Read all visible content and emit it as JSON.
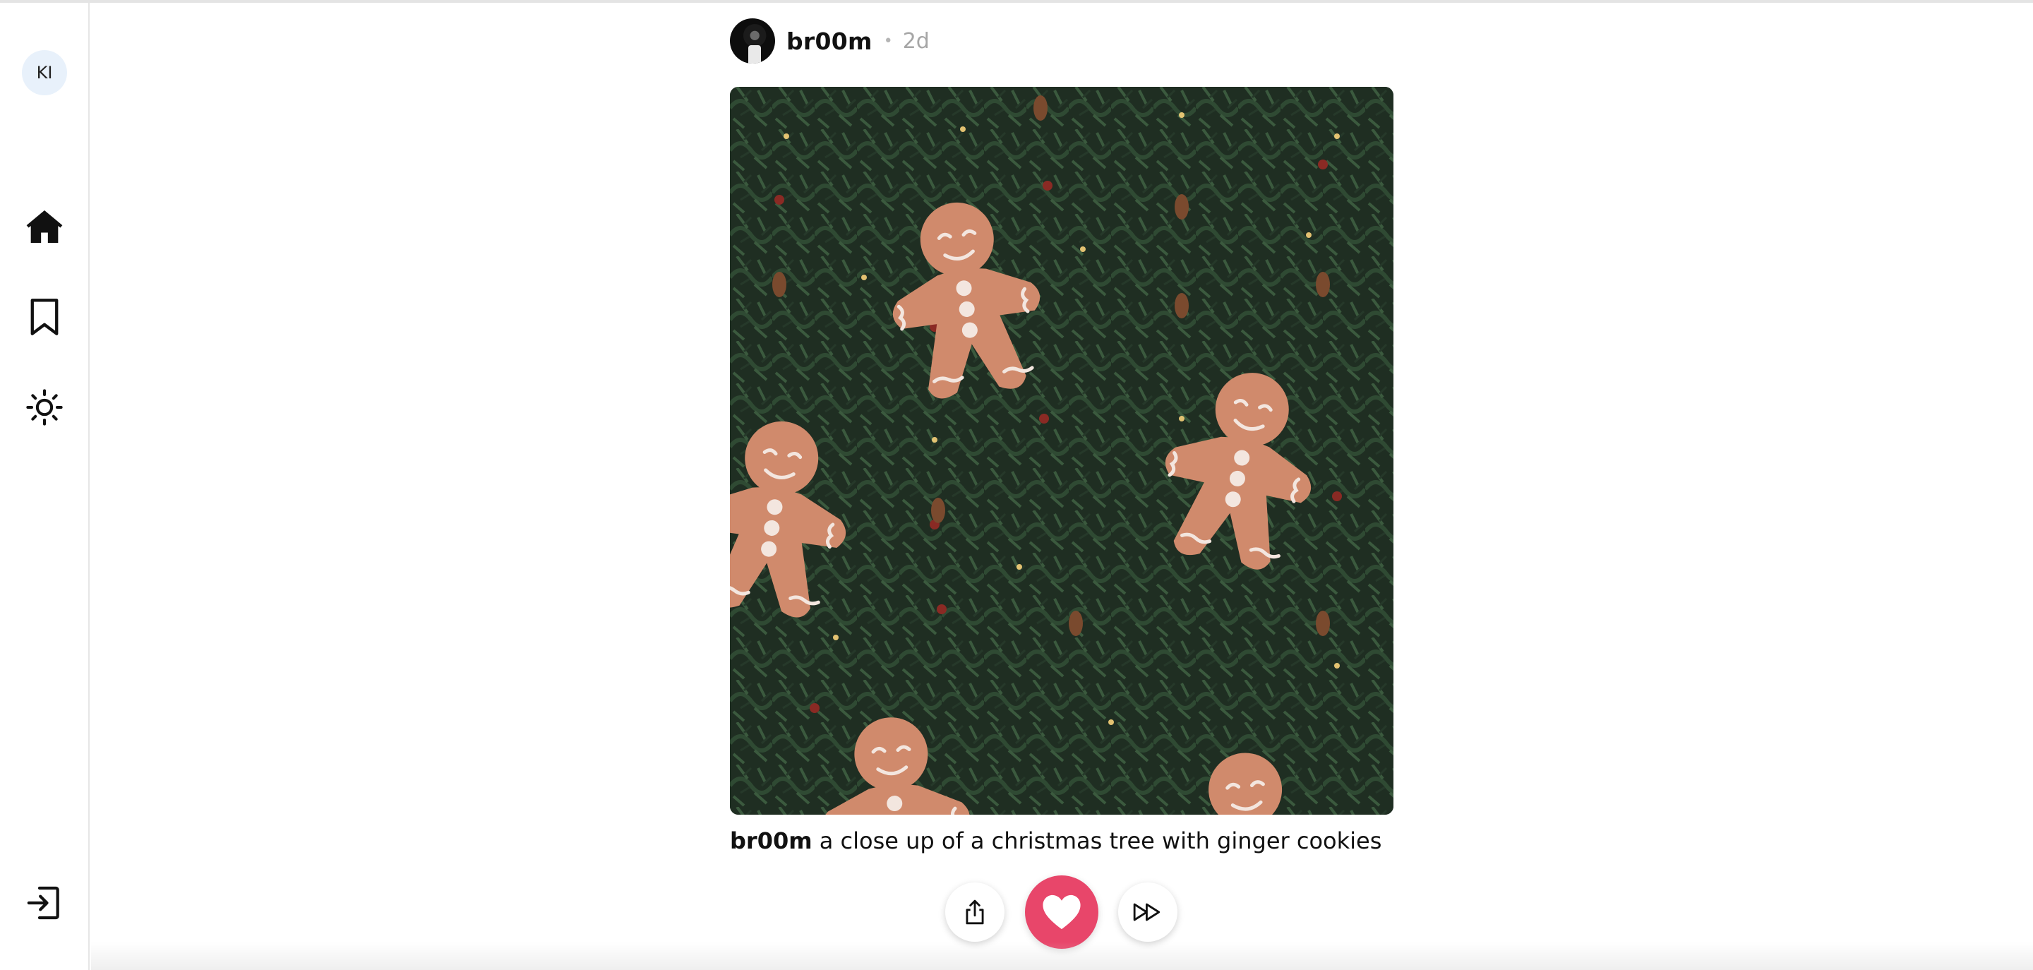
{
  "sidebar": {
    "user_initials": "KI",
    "items": [
      {
        "icon": "home-icon"
      },
      {
        "icon": "bookmark-icon"
      },
      {
        "icon": "sun-icon"
      }
    ],
    "logout_icon": "logout-icon"
  },
  "post": {
    "username": "br00m",
    "separator": "•",
    "age": "2d",
    "image_icon": "gingerbread-photo",
    "caption_user": "br00m",
    "caption_text": "a close up of a christmas tree with ginger cookies",
    "actions": {
      "share_icon": "share-icon",
      "like_icon": "heart-icon",
      "skip_icon": "fast-forward-icon"
    },
    "liked": true
  },
  "colors": {
    "accent_like": "#e8466a",
    "avatar_bg": "#e8f1fb",
    "sidebar_border": "#e6e6e6"
  }
}
